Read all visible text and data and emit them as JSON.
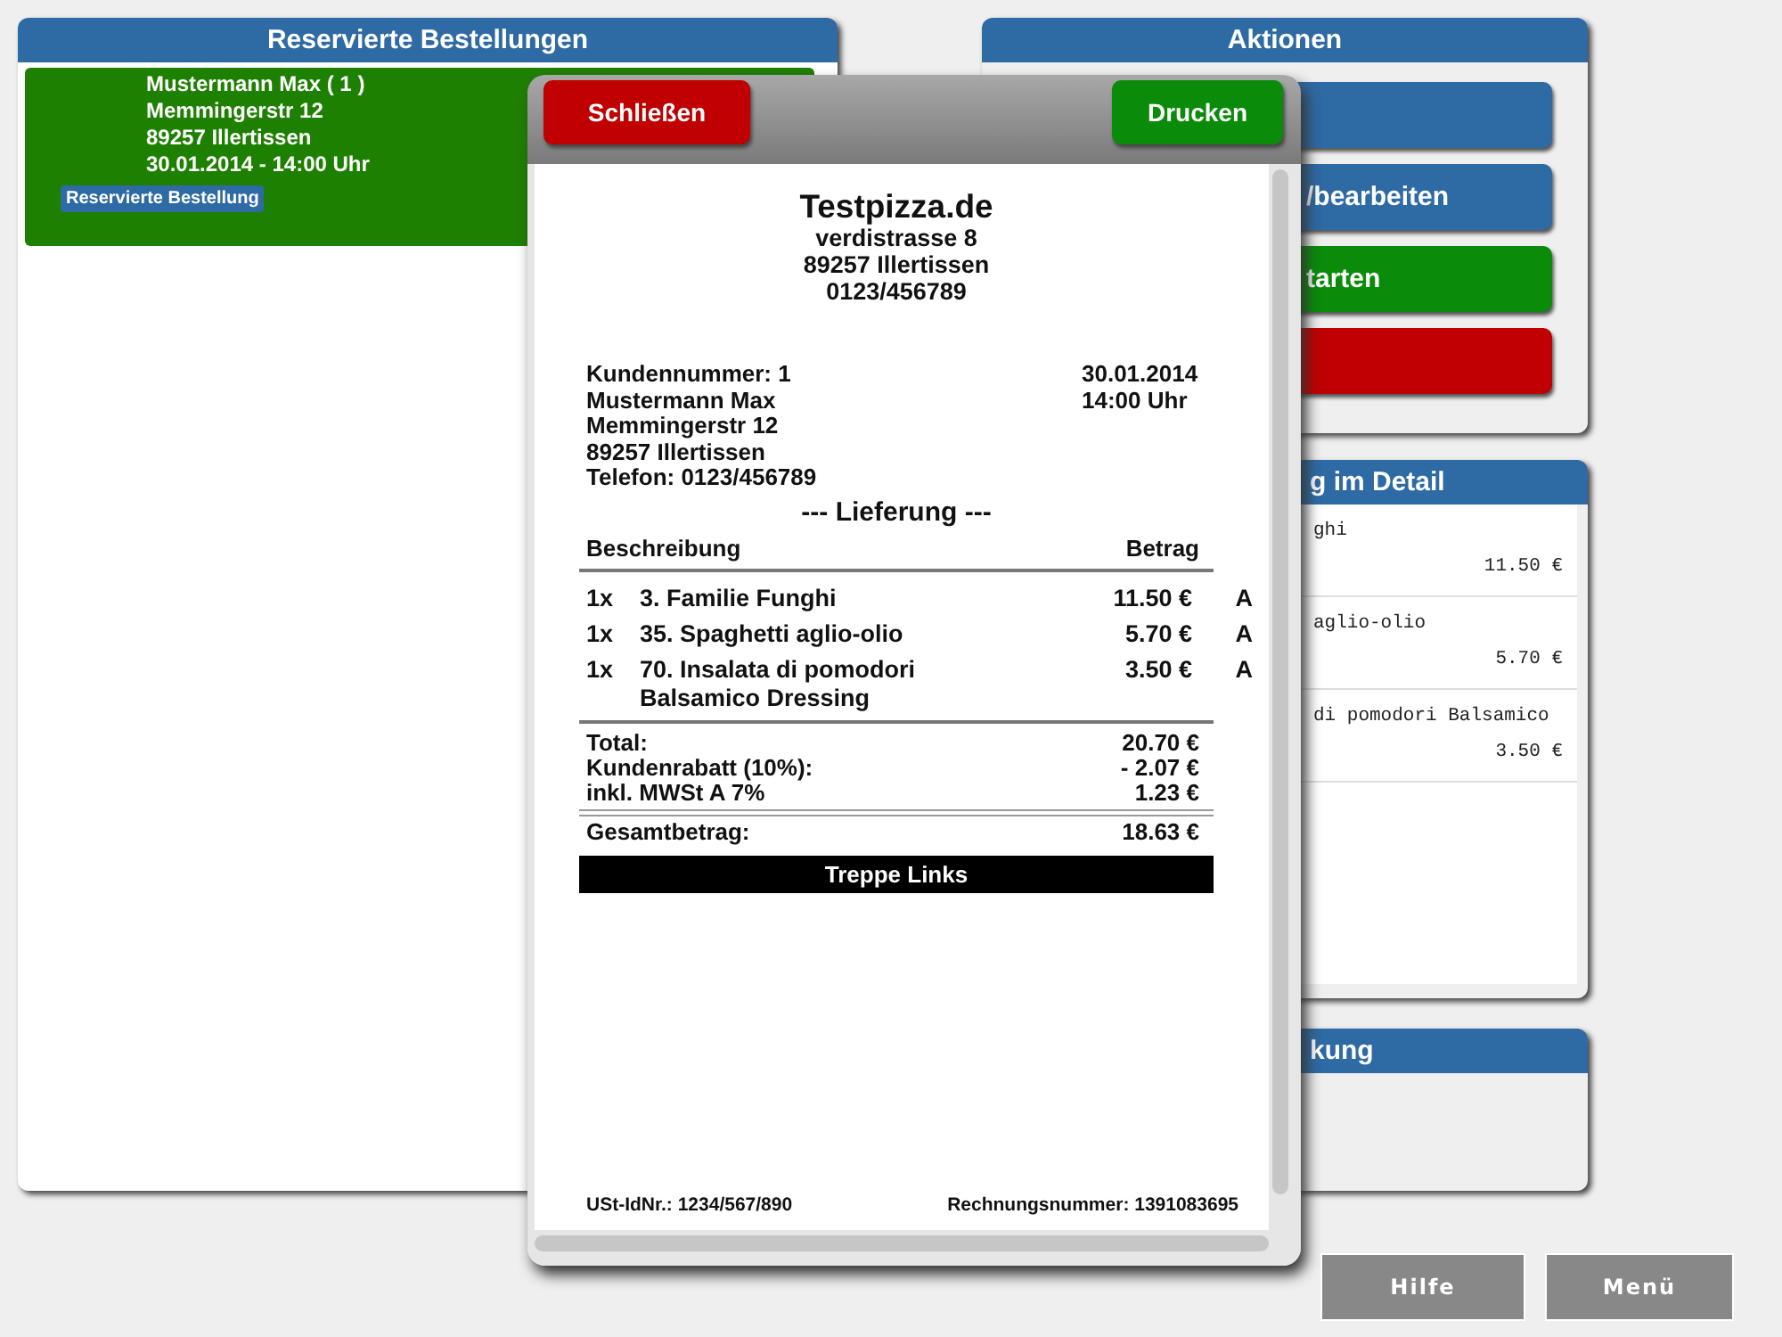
{
  "orders_panel": {
    "title": "Reservierte Bestellungen",
    "orders": [
      {
        "lines": [
          "Mustermann Max ( 1 )",
          "Memmingerstr 12",
          "89257 Illertissen",
          "30.01.2014 - 14:00 Uhr"
        ],
        "tag": "Reservierte Bestellung"
      }
    ]
  },
  "actions_panel": {
    "title": "Aktionen",
    "buttons": [
      {
        "color": "#2e6aa3"
      },
      {
        "label": "/bearbeiten",
        "color": "#2e6aa3"
      },
      {
        "label": "tarten",
        "color": "#0a8c0a"
      },
      {
        "color": "#c00000"
      }
    ]
  },
  "detail_panel": {
    "title": "g im Detail",
    "items": [
      {
        "name": "ghi",
        "price": "11.50 €"
      },
      {
        "name": "aglio-olio",
        "price": "5.70 €"
      },
      {
        "name": "di pomodori Balsamico",
        "price": "3.50 €"
      }
    ]
  },
  "note_panel": {
    "title": "kung"
  },
  "receipt_dialog": {
    "close_button": "Schließen",
    "print_button": "Drucken",
    "receipt": {
      "shop_name": "Testpizza.de",
      "shop_lines": [
        "verdistrasse 8",
        "89257 Illertissen",
        "0123/456789"
      ],
      "customer_lines": [
        "Kundennummer: 1",
        "Mustermann Max",
        "Memmingerstr 12",
        "89257 Illertissen",
        "Telefon: 0123/456789"
      ],
      "date": "30.01.2014",
      "time": "14:00 Uhr",
      "order_type": "--- Lieferung ---",
      "columns": [
        "Beschreibung",
        "Betrag"
      ],
      "items": [
        {
          "qty": "1x",
          "name": "3. Familie Funghi",
          "price": "11.50 €",
          "tax": "A"
        },
        {
          "qty": "1x",
          "name": "35. Spaghetti aglio-olio",
          "price": "5.70 €",
          "tax": "A"
        },
        {
          "qty": "1x",
          "name": "70. Insalata di pomodori Balsamico Dressing",
          "price": "3.50 €",
          "tax": "A"
        }
      ],
      "totals": [
        {
          "label": "Total:",
          "value": "20.70 €"
        },
        {
          "label": "Kundenrabatt (10%):",
          "value": "- 2.07 €"
        },
        {
          "label": "inkl. MWSt A 7%",
          "value": "1.23 €"
        }
      ],
      "grand_total": {
        "label": "Gesamtbetrag:",
        "value": "18.63 €"
      },
      "banner": "Treppe Links",
      "vat_id": "USt-IdNr.: 1234/567/890",
      "invoice_number": "Rechnungsnummer: 1391083695"
    }
  },
  "footer_buttons": [
    "Hilfe",
    "Menü"
  ]
}
